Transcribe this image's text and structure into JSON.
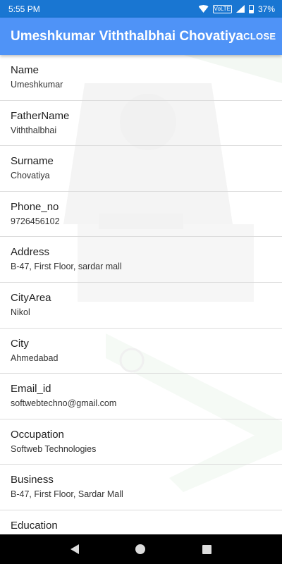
{
  "status_bar": {
    "time": "5:55 PM",
    "volte": "VoLTE",
    "battery": "37%",
    "icons": [
      "wifi-icon",
      "volte-icon",
      "signal-icon",
      "battery-icon"
    ]
  },
  "app_bar": {
    "title": "Umeshkumar Viththalbhai Chovatiya",
    "close_label": "CLOSE"
  },
  "fields": [
    {
      "label": "Name",
      "value": "Umeshkumar"
    },
    {
      "label": "FatherName",
      "value": "Viththalbhai"
    },
    {
      "label": "Surname",
      "value": "Chovatiya"
    },
    {
      "label": "Phone_no",
      "value": "9726456102"
    },
    {
      "label": "Address",
      "value": "B-47, First Floor, sardar mall"
    },
    {
      "label": "CityArea",
      "value": "Nikol"
    },
    {
      "label": "City",
      "value": "Ahmedabad"
    },
    {
      "label": "Email_id",
      "value": "softwebtechno@gmail.com"
    },
    {
      "label": "Occupation",
      "value": "Softweb Technologies"
    },
    {
      "label": "Business",
      "value": "B-47, First Floor, Sardar Mall"
    },
    {
      "label": "Education",
      "value": ""
    }
  ],
  "nav_bar": {
    "icons": [
      "back-icon",
      "home-icon",
      "recents-icon"
    ]
  },
  "colors": {
    "status_bar": "#1976d2",
    "app_bar": "#4f93f7",
    "divider": "#dcdcdc"
  }
}
